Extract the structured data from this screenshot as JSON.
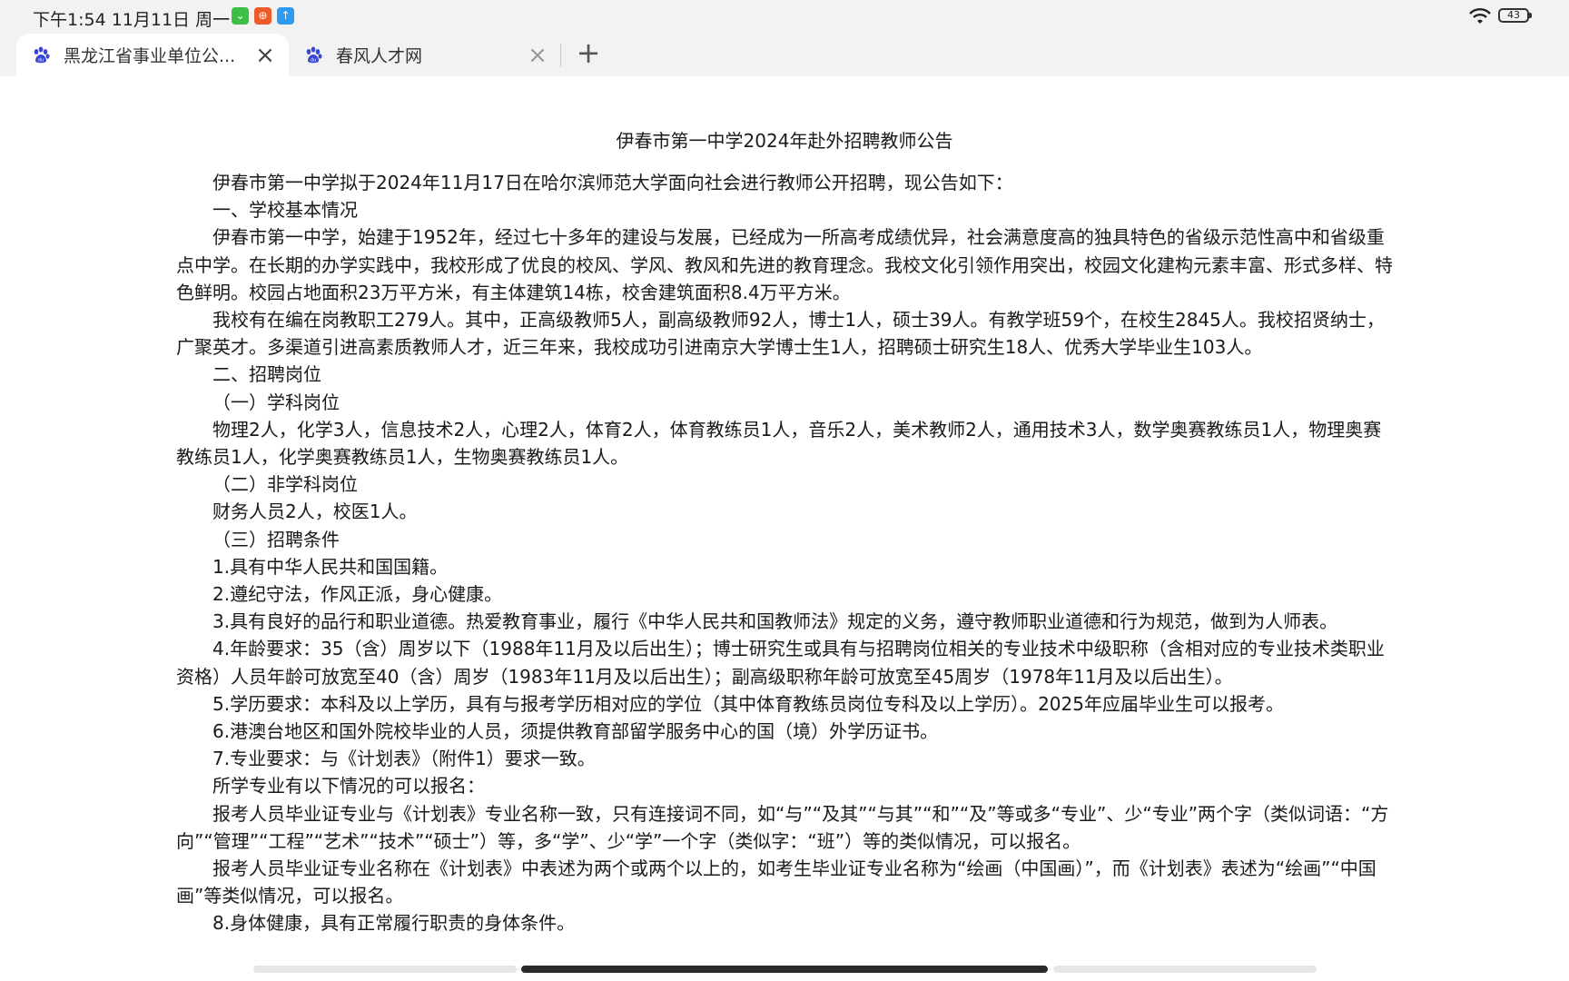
{
  "status_bar": {
    "time": "下午1:54 11月11日 周一",
    "battery": "43",
    "app_icons": [
      {
        "name": "wechat-icon",
        "color": "#3dbf45",
        "glyph": "⌄"
      },
      {
        "name": "app-orange-icon",
        "color": "#f05a28",
        "glyph": "⊕"
      },
      {
        "name": "app-blue-icon",
        "color": "#2e9bf0",
        "glyph": "↑"
      }
    ]
  },
  "tabs": [
    {
      "title": "黑龙江省事业单位公...",
      "active": true
    },
    {
      "title": "春风人才网",
      "active": false
    }
  ],
  "article": {
    "title": "伊春市第一中学2024年赴外招聘教师公告",
    "paragraphs": [
      "伊春市第一中学拟于2024年11月17日在哈尔滨师范大学面向社会进行教师公开招聘，现公告如下：",
      "一、学校基本情况",
      "伊春市第一中学，始建于1952年，经过七十多年的建设与发展，已经成为一所高考成绩优异，社会满意度高的独具特色的省级示范性高中和省级重点中学。在长期的办学实践中，我校形成了优良的校风、学风、教风和先进的教育理念。我校文化引领作用突出，校园文化建构元素丰富、形式多样、特色鲜明。校园占地面积23万平方米，有主体建筑14栋，校舍建筑面积8.4万平方米。",
      "我校有在编在岗教职工279人。其中，正高级教师5人，副高级教师92人，博士1人，硕士39人。有教学班59个，在校生2845人。我校招贤纳士，广聚英才。多渠道引进高素质教师人才，近三年来，我校成功引进南京大学博士生1人，招聘硕士研究生18人、优秀大学毕业生103人。",
      "二、招聘岗位",
      "（一）学科岗位",
      "物理2人，化学3人，信息技术2人，心理2人，体育2人，体育教练员1人，音乐2人，美术教师2人，通用技术3人，数学奥赛教练员1人，物理奥赛教练员1人，化学奥赛教练员1人，生物奥赛教练员1人。",
      "（二）非学科岗位",
      "财务人员2人，校医1人。",
      "（三）招聘条件",
      "1.具有中华人民共和国国籍。",
      "2.遵纪守法，作风正派，身心健康。",
      "3.具有良好的品行和职业道德。热爱教育事业，履行《中华人民共和国教师法》规定的义务，遵守教师职业道德和行为规范，做到为人师表。",
      "4.年龄要求：35（含）周岁以下（1988年11月及以后出生）；博士研究生或具有与招聘岗位相关的专业技术中级职称（含相对应的专业技术类职业资格）人员年龄可放宽至40（含）周岁（1983年11月及以后出生）；副高级职称年龄可放宽至45周岁（1978年11月及以后出生）。",
      "5.学历要求：本科及以上学历，具有与报考学历相对应的学位（其中体育教练员岗位专科及以上学历）。2025年应届毕业生可以报考。",
      "6.港澳台地区和国外院校毕业的人员，须提供教育部留学服务中心的国（境）外学历证书。",
      "7.专业要求：与《计划表》（附件1）要求一致。",
      "所学专业有以下情况的可以报名：",
      "报考人员毕业证专业与《计划表》专业名称一致，只有连接词不同，如“与”“及其”“与其”“和”“及”等或多“专业”、少“专业”两个字（类似词语：“方向”“管理”“工程”“艺术”“技术”“硕士”）等，多“学”、少“学”一个字（类似字：“班”）等的类似情况，可以报名。",
      "报考人员毕业证专业名称在《计划表》中表述为两个或两个以上的，如考生毕业证专业名称为“绘画（中国画）”，而《计划表》表述为“绘画”“中国画”等类似情况，可以报名。",
      "8.身体健康，具有正常履行职责的身体条件。"
    ]
  }
}
